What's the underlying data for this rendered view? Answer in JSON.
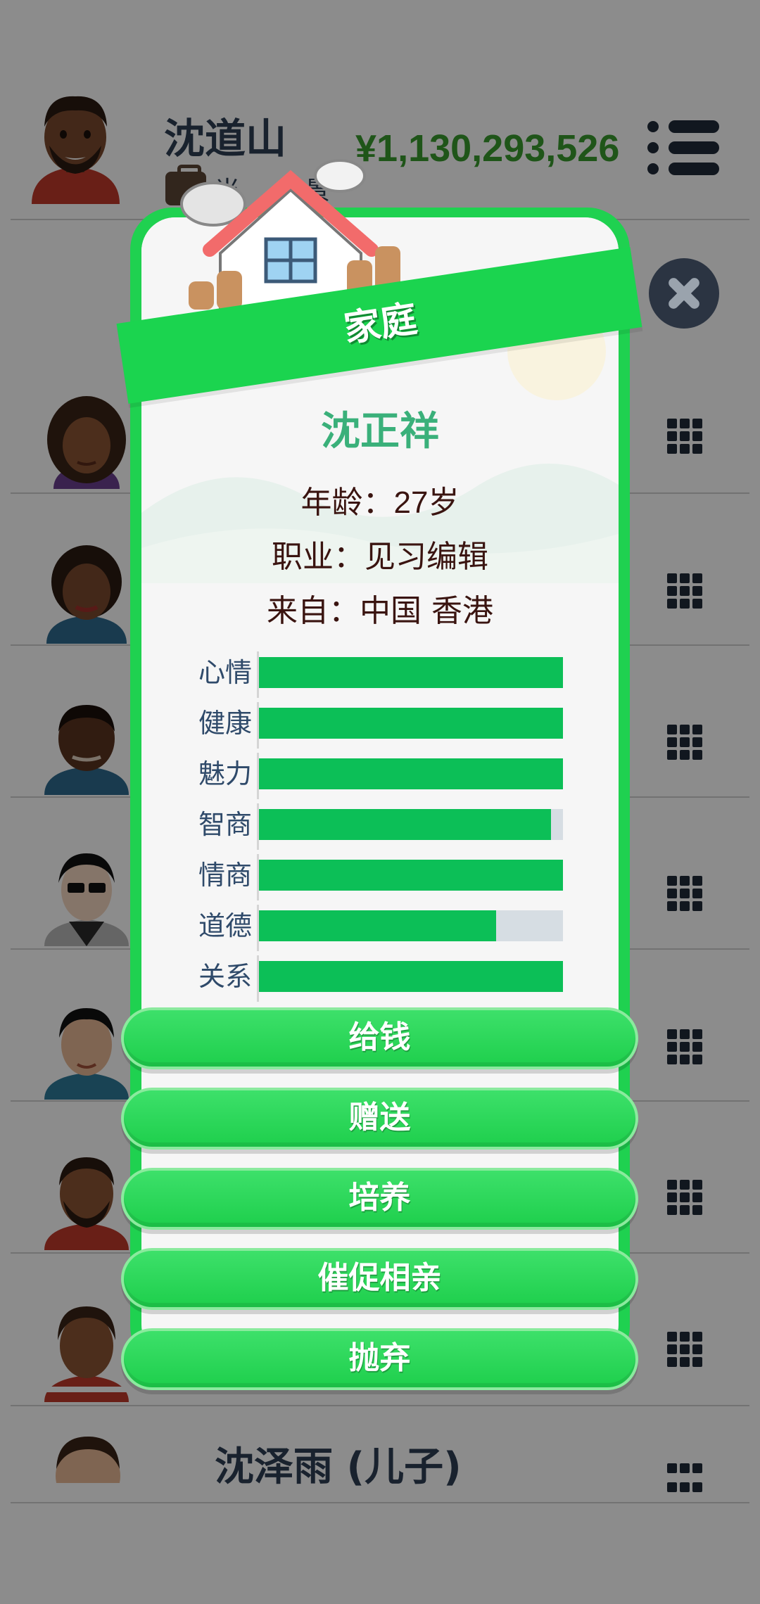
{
  "header": {
    "player_name": "沈道山",
    "status_text": "当",
    "status_text_right": "景",
    "money": "¥1,130,293,526"
  },
  "list": {
    "last_row_name": "沈泽雨 (儿子)"
  },
  "modal": {
    "title": "家庭",
    "person": {
      "name": "沈正祥",
      "age_label": "年龄：",
      "age_value": "27岁",
      "job_label": "职业：",
      "job_value": "见习编辑",
      "from_label": "来自：",
      "from_value": "中国 香港"
    },
    "stats": [
      {
        "label": "心情",
        "value": 1.0
      },
      {
        "label": "健康",
        "value": 1.0
      },
      {
        "label": "魅力",
        "value": 1.0
      },
      {
        "label": "智商",
        "value": 0.96
      },
      {
        "label": "情商",
        "value": 1.0
      },
      {
        "label": "道德",
        "value": 0.78
      },
      {
        "label": "关系",
        "value": 1.0
      }
    ],
    "actions": [
      "给钱",
      "赠送",
      "培养",
      "催促相亲",
      "抛弃"
    ]
  },
  "colors": {
    "accent_green": "#1fd150",
    "bar_green": "#0cbf57",
    "money_green": "#3a9b2e",
    "name_teal": "#3ab07a"
  },
  "icons": [
    "menu-icon",
    "briefcase-icon",
    "close-icon",
    "grid-icon",
    "house-icon"
  ]
}
